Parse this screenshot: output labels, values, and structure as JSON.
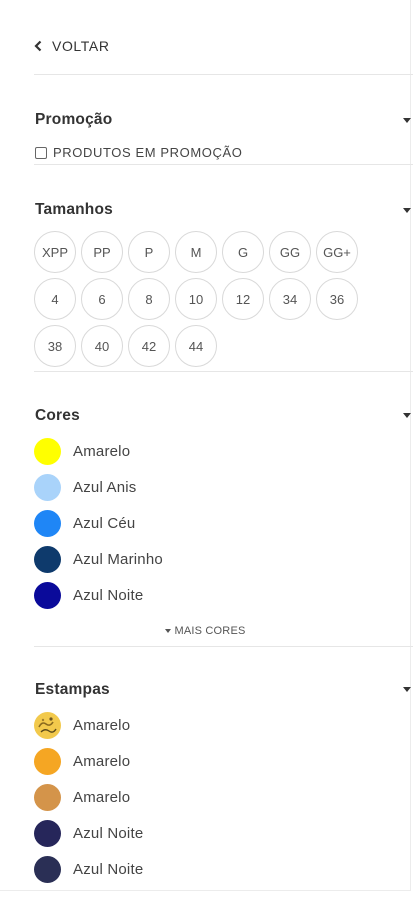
{
  "nav": {
    "back_label": "VOLTAR"
  },
  "promo": {
    "title": "Promoção",
    "checkbox_label": "PRODUTOS EM PROMOÇÃO"
  },
  "sizes": {
    "title": "Tamanhos",
    "items": [
      "XPP",
      "PP",
      "P",
      "M",
      "G",
      "GG",
      "GG+",
      "4",
      "6",
      "8",
      "10",
      "12",
      "34",
      "36",
      "38",
      "40",
      "42",
      "44"
    ]
  },
  "colors": {
    "title": "Cores",
    "items": [
      {
        "label": "Amarelo",
        "color": "#ffff00"
      },
      {
        "label": "Azul Anis",
        "color": "#a9d3fa"
      },
      {
        "label": "Azul Céu",
        "color": "#1f86f6"
      },
      {
        "label": "Azul Marinho",
        "color": "#0e3a6c"
      },
      {
        "label": "Azul Noite",
        "color": "#0a0a9a"
      }
    ],
    "more_label": "MAIS CORES"
  },
  "prints": {
    "title": "Estampas",
    "items": [
      {
        "label": "Amarelo",
        "color": "#f2c94c",
        "pattern": "patterned-icon"
      },
      {
        "label": "Amarelo",
        "color": "#f5a623"
      },
      {
        "label": "Amarelo",
        "color": "#d4944a"
      },
      {
        "label": "Azul Noite",
        "color": "#26265a"
      },
      {
        "label": "Azul Noite",
        "color": "#2a2f55"
      }
    ]
  }
}
